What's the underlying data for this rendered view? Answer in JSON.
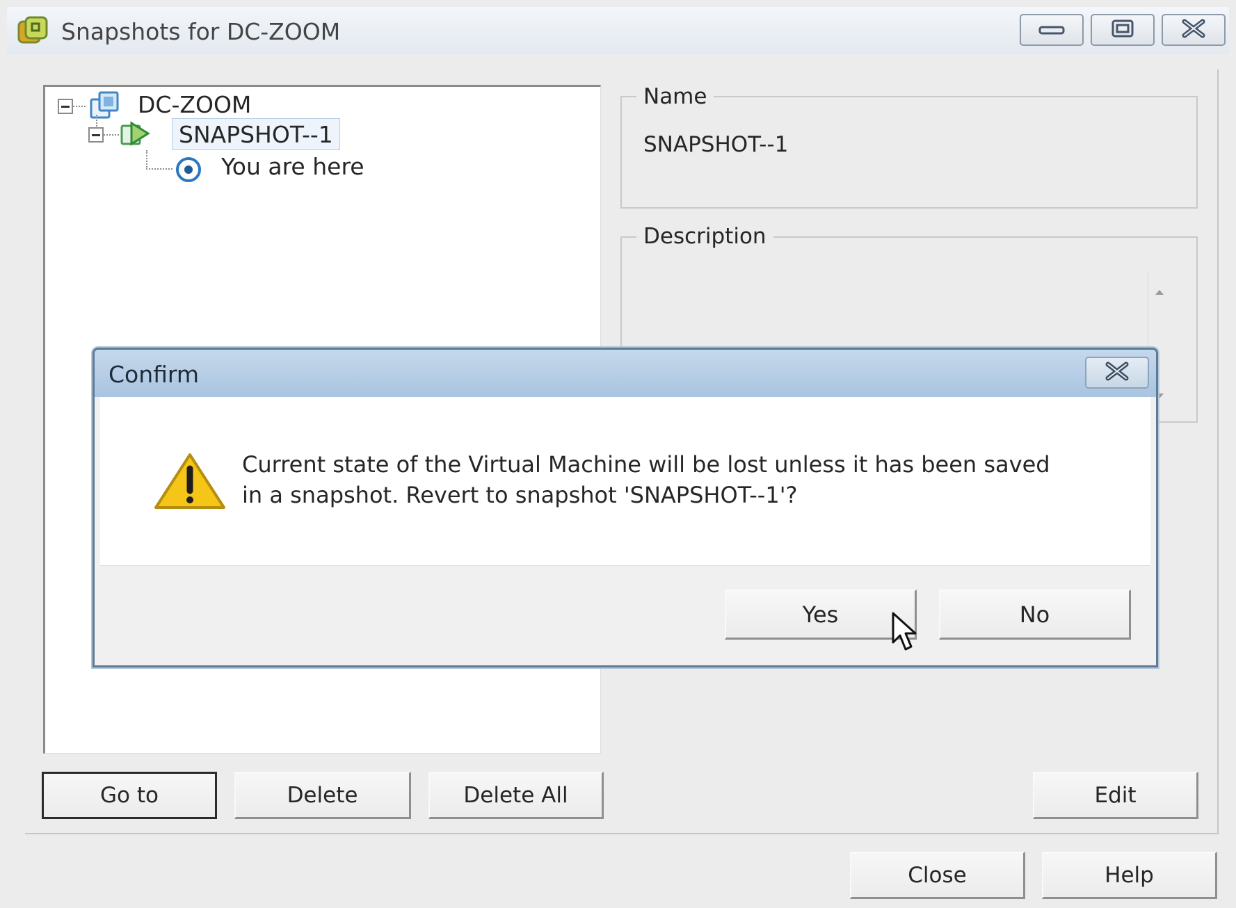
{
  "window": {
    "title": "Snapshots for DC-ZOOM",
    "controls": {
      "minimize_icon": "minimize-icon",
      "maximize_icon": "maximize-icon",
      "close_icon": "close-icon"
    }
  },
  "tree": {
    "root_label": "DC-ZOOM",
    "snapshot_label": "SNAPSHOT--1",
    "current_label": "You are here"
  },
  "details": {
    "name_legend": "Name",
    "name_value": "SNAPSHOT--1",
    "description_legend": "Description",
    "description_value": ""
  },
  "actions": {
    "goto_label": "Go to",
    "delete_label": "Delete",
    "delete_all_label": "Delete All",
    "edit_label": "Edit",
    "close_label": "Close",
    "help_label": "Help"
  },
  "dialog": {
    "title": "Confirm",
    "message": "Current state of the Virtual Machine will be lost unless it has been saved in a snapshot. Revert to snapshot 'SNAPSHOT--1'?",
    "yes_label": "Yes",
    "no_label": "No",
    "icon": "warning-icon"
  },
  "colors": {
    "dialog_title_bg": "#b5cde6",
    "dialog_border": "#5e7a96",
    "warning_yellow": "#f5c518"
  }
}
